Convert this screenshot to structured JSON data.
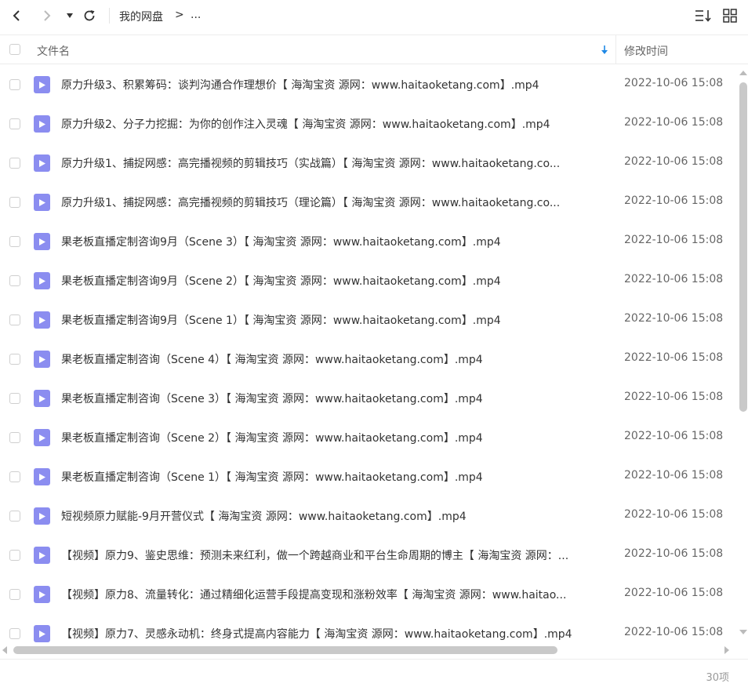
{
  "breadcrumb": {
    "root": "我的网盘",
    "separator": ">",
    "more": "..."
  },
  "header": {
    "select_all_label": "",
    "col_name": "文件名",
    "col_time": "修改时间",
    "sort_direction": "descending"
  },
  "icons": {
    "back": "back-icon",
    "forward": "forward-icon",
    "dropdown": "dropdown-icon",
    "refresh": "refresh-icon",
    "sort": "sort-icon",
    "grid": "grid-view-icon",
    "file": "video-file-icon"
  },
  "colors": {
    "file_icon": "#8b8df0",
    "sort_arrow": "#1e88e5"
  },
  "files": [
    {
      "name": "原力升级3、积累筹码：谈判沟通合作理想价【 海淘宝资 源网：www.haitaoketang.com】.mp4",
      "time": "2022-10-06 15:08"
    },
    {
      "name": "原力升级2、分子力挖掘：为你的创作注入灵魂【 海淘宝资 源网：www.haitaoketang.com】.mp4",
      "time": "2022-10-06 15:08"
    },
    {
      "name": "原力升级1、捕捉网感：高完播视频的剪辑技巧（实战篇）【 海淘宝资 源网：www.haitaoketang.co...",
      "time": "2022-10-06 15:08"
    },
    {
      "name": "原力升级1、捕捉网感：高完播视频的剪辑技巧（理论篇）【 海淘宝资 源网：www.haitaoketang.co...",
      "time": "2022-10-06 15:08"
    },
    {
      "name": "果老板直播定制咨询9月（Scene 3）【 海淘宝资 源网：www.haitaoketang.com】.mp4",
      "time": "2022-10-06 15:08"
    },
    {
      "name": "果老板直播定制咨询9月（Scene 2）【 海淘宝资 源网：www.haitaoketang.com】.mp4",
      "time": "2022-10-06 15:08"
    },
    {
      "name": "果老板直播定制咨询9月（Scene 1）【 海淘宝资 源网：www.haitaoketang.com】.mp4",
      "time": "2022-10-06 15:08"
    },
    {
      "name": "果老板直播定制咨询（Scene 4）【 海淘宝资 源网：www.haitaoketang.com】.mp4",
      "time": "2022-10-06 15:08"
    },
    {
      "name": "果老板直播定制咨询（Scene 3）【 海淘宝资 源网：www.haitaoketang.com】.mp4",
      "time": "2022-10-06 15:08"
    },
    {
      "name": "果老板直播定制咨询（Scene 2）【 海淘宝资 源网：www.haitaoketang.com】.mp4",
      "time": "2022-10-06 15:08"
    },
    {
      "name": "果老板直播定制咨询（Scene 1）【 海淘宝资 源网：www.haitaoketang.com】.mp4",
      "time": "2022-10-06 15:08"
    },
    {
      "name": "短视频原力赋能-9月开营仪式【 海淘宝资 源网：www.haitaoketang.com】.mp4",
      "time": "2022-10-06 15:08"
    },
    {
      "name": "【视频】原力9、鉴史思维：预测未来红利，做一个跨越商业和平台生命周期的博主【 海淘宝资 源网：...",
      "time": "2022-10-06 15:08"
    },
    {
      "name": "【视频】原力8、流量转化：通过精细化运营手段提高变现和涨粉效率【 海淘宝资 源网：www.haitao...",
      "time": "2022-10-06 15:08"
    },
    {
      "name": "【视频】原力7、灵感永动机：终身式提高内容能力【 海淘宝资 源网：www.haitaoketang.com】.mp4",
      "time": "2022-10-06 15:08"
    }
  ],
  "footer": {
    "count": "30项"
  }
}
